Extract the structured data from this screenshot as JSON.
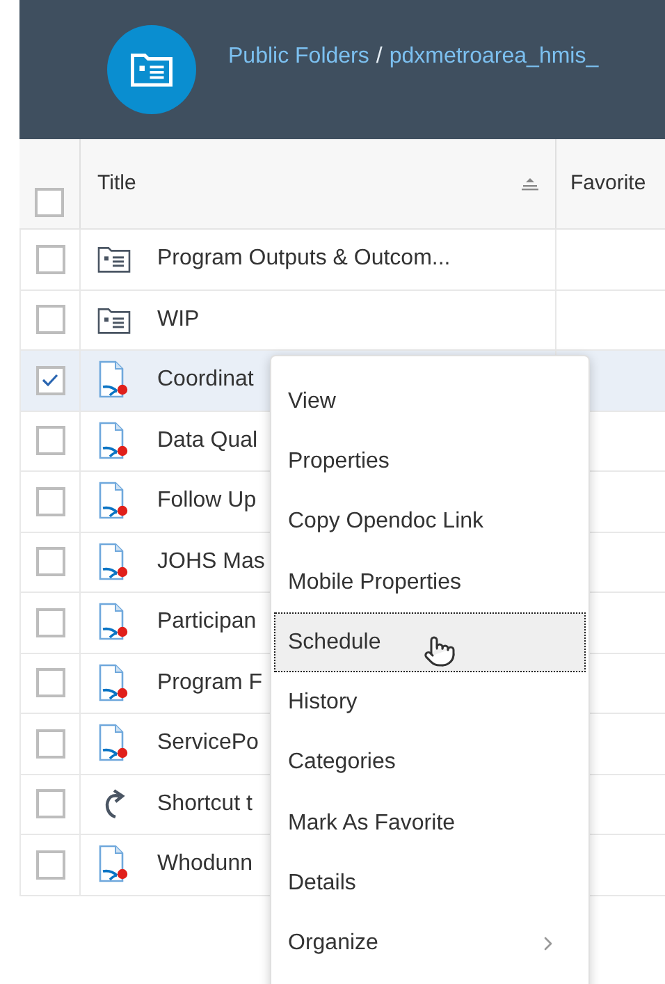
{
  "breadcrumb": [
    {
      "text": "Public Folders",
      "kind": "link"
    },
    {
      "text": "/",
      "kind": "separator"
    },
    {
      "text": "pdxmetroarea_hmis_",
      "kind": "link"
    }
  ],
  "table": {
    "select_all_checked": false,
    "columns": [
      "Title",
      "Favorite"
    ],
    "rows": [
      {
        "kind": "folder",
        "title": "Program Outputs & Outcom...",
        "checked": false,
        "selected": false
      },
      {
        "kind": "folder",
        "title": "WIP",
        "checked": false,
        "selected": false
      },
      {
        "kind": "report",
        "title": "Coordinat",
        "checked": true,
        "selected": true
      },
      {
        "kind": "report",
        "title": "Data Qual",
        "checked": false,
        "selected": false
      },
      {
        "kind": "report",
        "title": "Follow Up",
        "checked": false,
        "selected": false
      },
      {
        "kind": "report",
        "title": "JOHS Mas",
        "checked": false,
        "selected": false
      },
      {
        "kind": "report",
        "title": "Participan",
        "checked": false,
        "selected": false
      },
      {
        "kind": "report",
        "title": "Program F",
        "checked": false,
        "selected": false
      },
      {
        "kind": "report",
        "title": "ServicePo",
        "checked": false,
        "selected": false
      },
      {
        "kind": "shortcut",
        "title": "Shortcut t",
        "checked": false,
        "selected": false
      },
      {
        "kind": "report",
        "title": "Whodunn",
        "checked": false,
        "selected": false
      }
    ]
  },
  "context_menu": {
    "items": [
      {
        "label": "View",
        "selected": false,
        "submenu": false
      },
      {
        "label": "Properties",
        "selected": false,
        "submenu": false
      },
      {
        "label": "Copy Opendoc Link",
        "selected": false,
        "submenu": false
      },
      {
        "label": "Mobile Properties",
        "selected": false,
        "submenu": false
      },
      {
        "label": "Schedule",
        "selected": true,
        "submenu": false
      },
      {
        "label": "History",
        "selected": false,
        "submenu": false
      },
      {
        "label": "Categories",
        "selected": false,
        "submenu": false
      },
      {
        "label": "Mark As Favorite",
        "selected": false,
        "submenu": false
      },
      {
        "label": "Details",
        "selected": false,
        "submenu": false
      },
      {
        "label": "Organize",
        "selected": false,
        "submenu": true
      }
    ]
  }
}
